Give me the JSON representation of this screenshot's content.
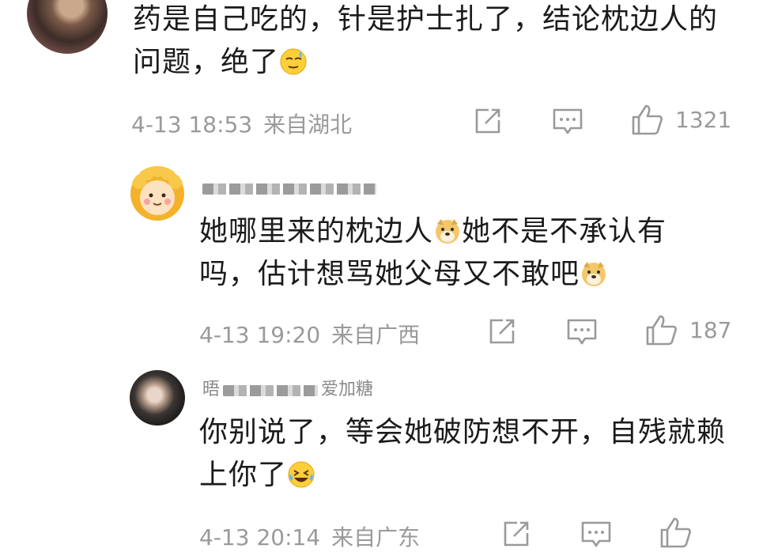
{
  "comments": [
    {
      "text": "药是自己吃的，针是护士扎了，结论枕边人的问题，绝了",
      "emoji": "sweat-smile-emoji",
      "date": "4-13 18:53",
      "location": "来自湖北",
      "likes": "1321",
      "avatar": "user-photo-dark"
    },
    {
      "username_masked": "",
      "text": "她哪里来的枕边人",
      "text_after_emoji_1": "她不是不承认有吗，估计想骂她父母又不敢吧",
      "emoji": "doge-emoji",
      "date": "4-13 19:20",
      "location": "来自广西",
      "likes": "187",
      "avatar": "lion-cartoon-avatar"
    },
    {
      "username_partial": "晤",
      "username_visible_tail": "爱加糖",
      "text": "你别说了，等会她破防想不开，自残就赖上你了",
      "emoji": "laugh-cry-emoji",
      "date": "4-13 20:14",
      "location": "来自广东",
      "avatar": "user-photo-portrait"
    }
  ],
  "icons": {
    "share": "share-icon",
    "comment": "comment-icon",
    "like": "thumbs-up-icon"
  },
  "colors": {
    "meta_gray": "#9a9a9a",
    "text": "#1b1b1b",
    "background": "#ffffff"
  }
}
